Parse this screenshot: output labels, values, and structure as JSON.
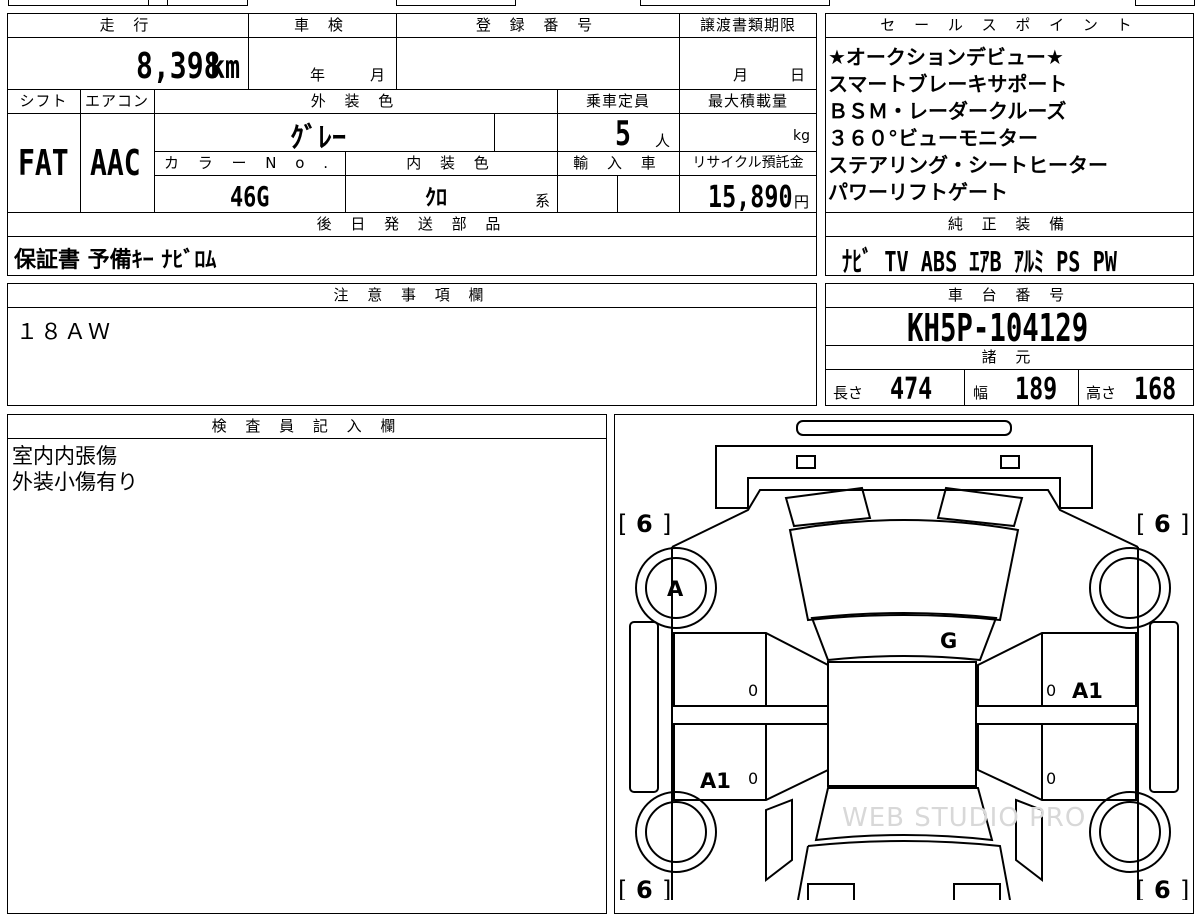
{
  "headers": {
    "mileage": "走 行",
    "inspection": "車 検",
    "registration": "登 録 番 号",
    "transfer_deadline": "譲渡書類期限",
    "shift": "シフト",
    "aircon": "エアコン",
    "exterior_color": "外 装 色",
    "capacity": "乗車定員",
    "max_load": "最大積載量",
    "color_no": "カ ラ ー N o .",
    "interior_color": "内 装 色",
    "import": "輸 入 車",
    "recycle": "リサイクル預託金",
    "later_parts": "後 日 発 送 部 品",
    "sales_points": "セ ー ル ス ポ イ ン ト",
    "factory_equipment": "純 正 装 備",
    "notes": "注 意 事 項 欄",
    "chassis_no": "車 台 番 号",
    "specs": "諸 元",
    "inspector_notes": "検 査 員 記 入 欄"
  },
  "vehicle": {
    "mileage": "8,398",
    "mileage_unit": "km",
    "inspection_year_unit": "年",
    "inspection_month_unit": "月",
    "transfer_month_unit": "月",
    "transfer_day_unit": "日",
    "shift": "FAT",
    "aircon": "AAC",
    "exterior_color": "ｸﾞﾚｰ",
    "capacity": "5",
    "capacity_unit": "人",
    "max_load_unit": "kg",
    "color_no": "46G",
    "interior_color": "ｸﾛ",
    "interior_suffix": "系",
    "recycle_fee": "15,890",
    "recycle_unit": "円",
    "later_parts": "保証書 予備ｷｰ ﾅﾋﾞﾛﾑ",
    "notes": "１８ＡＷ",
    "chassis_no": "KH5P-104129"
  },
  "sales_points": [
    "★オークションデビュー★",
    "スマートブレーキサポート",
    "ＢＳＭ・レーダークルーズ",
    "３６０°ビューモニター",
    "ステアリング・シートヒーター",
    "パワーリフトゲート"
  ],
  "factory_equipment": "ﾅﾋﾞ TV ABS ｴｱB ｱﾙﾐ PS PW",
  "specs": {
    "length_label": "長さ",
    "length": "474",
    "width_label": "幅",
    "width": "189",
    "height_label": "高さ",
    "height": "168"
  },
  "inspector_notes": [
    "室内内張傷",
    "外装小傷有り"
  ],
  "diagram": {
    "tire_fl": "6",
    "tire_fr": "6",
    "tire_rl": "6",
    "tire_rr": "6",
    "mark_front_left": "A",
    "mark_windshield": "G",
    "mark_right_front_door": "A1",
    "mark_left_rear_door": "A1",
    "zero": "0"
  },
  "watermark": "WEB STUDIO PRO"
}
